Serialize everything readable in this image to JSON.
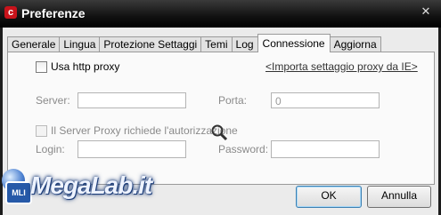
{
  "window": {
    "title": "Preferenze",
    "logo_letter": "c",
    "close_glyph": "✕"
  },
  "tabs": [
    {
      "label": "Generale",
      "active": false
    },
    {
      "label": "Lingua",
      "active": false
    },
    {
      "label": "Protezione Settaggi",
      "active": false
    },
    {
      "label": "Temi",
      "active": false
    },
    {
      "label": "Log",
      "active": false
    },
    {
      "label": "Connessione",
      "active": true
    },
    {
      "label": "Aggiorna",
      "active": false
    }
  ],
  "connection": {
    "use_proxy_label": "Usa http proxy",
    "use_proxy_checked": false,
    "import_link": "<Importa settaggio proxy da IE>",
    "server_label": "Server:",
    "server_value": "",
    "port_label": "Porta:",
    "port_value": "0",
    "auth_label": "Il Server Proxy richiede l'autorizzazione",
    "auth_checked": false,
    "login_label": "Login:",
    "login_value": "",
    "password_label": "Password:",
    "password_value": ""
  },
  "buttons": {
    "ok": "OK",
    "cancel": "Annulla"
  },
  "watermark": {
    "text": "MegaLab.it",
    "badge": "MLI"
  },
  "colors": {
    "titlebar": "#111111",
    "logo": "#c8131b",
    "panel": "#ebebeb"
  }
}
